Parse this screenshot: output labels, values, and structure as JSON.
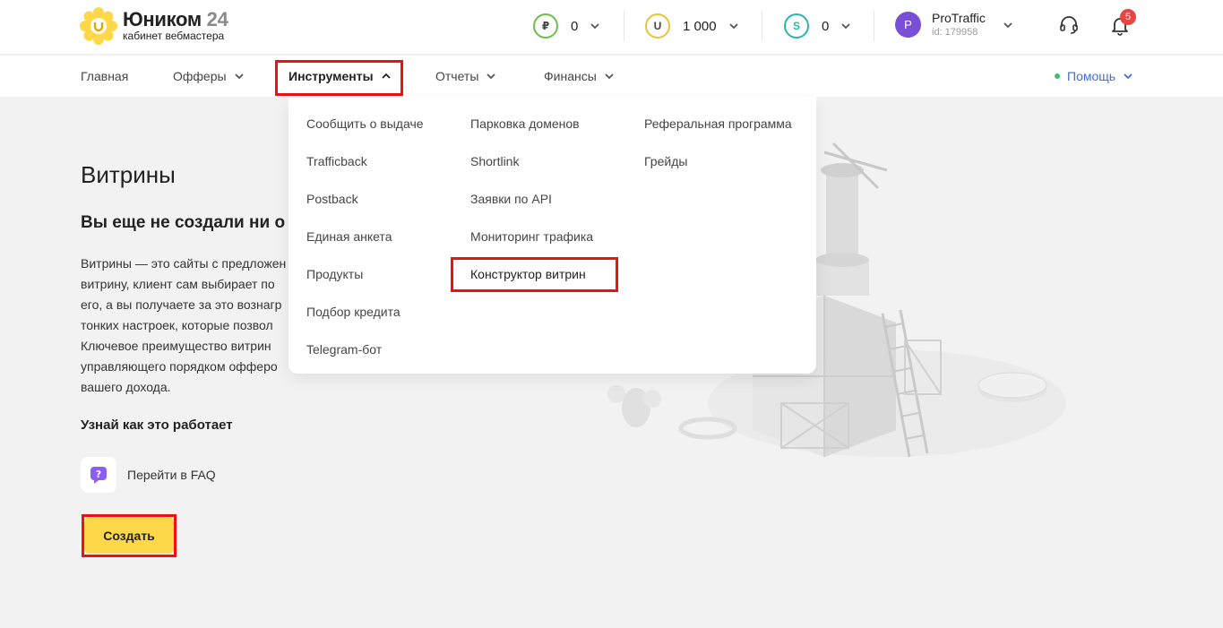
{
  "brand": {
    "name": "Юником",
    "number": "24",
    "subtitle": "кабинет вебмастера",
    "color": "#ffd84a"
  },
  "balances": [
    {
      "symbol": "₽",
      "value": "0",
      "color": "#6cbf4a"
    },
    {
      "symbol": "U",
      "value": "1 000",
      "color": "#e8c43a"
    },
    {
      "symbol": "S",
      "value": "0",
      "color": "#2bb5b0"
    }
  ],
  "user": {
    "initial": "P",
    "name": "ProTraffic",
    "id": "id: 179958"
  },
  "notifications": {
    "count": "5"
  },
  "nav": {
    "items": [
      {
        "label": "Главная"
      },
      {
        "label": "Офферы"
      },
      {
        "label": "Инструменты"
      },
      {
        "label": "Отчеты"
      },
      {
        "label": "Финансы"
      }
    ],
    "help": "Помощь"
  },
  "dropdown": {
    "col1": [
      "Сообщить о выдаче",
      "Trafficback",
      "Postback",
      "Единая анкета",
      "Продукты",
      "Подбор кредита",
      "Telegram-бот"
    ],
    "col2": [
      "Парковка доменов",
      "Shortlink",
      "Заявки по API",
      "Мониторинг трафика",
      "Конструктор витрин"
    ],
    "col3": [
      "Реферальная программа",
      "Грейды"
    ]
  },
  "page": {
    "title": "Витрины",
    "subtitle": "Вы еще не создали ни о",
    "description": [
      "Витрины — это сайты с предложен",
      "витрину, клиент сам выбирает по",
      "его, а вы получаете за это вознагр",
      "тонких настроек, которые позвол",
      "Ключевое преимущество витрин",
      "управляющего порядком офферо",
      "вашего дохода."
    ],
    "how_title": "Узнай как это работает",
    "faq_label": "Перейти в FAQ",
    "create_label": "Создать"
  }
}
